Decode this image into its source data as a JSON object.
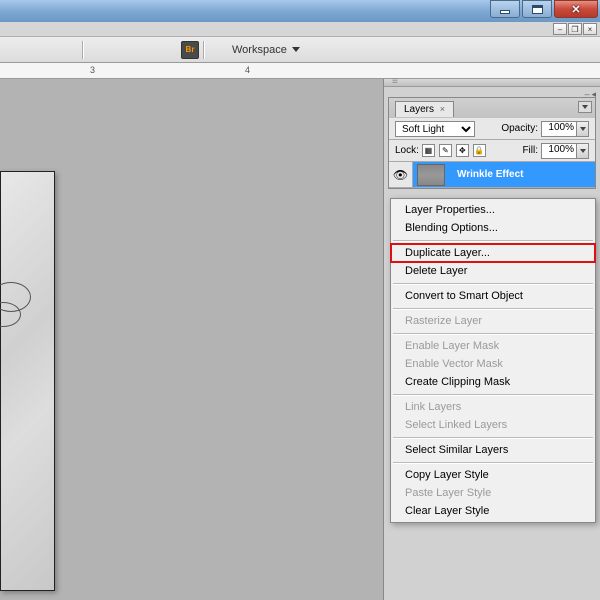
{
  "toolbar": {
    "bridge": "Br",
    "workspace_label": "Workspace"
  },
  "ruler": {
    "marks": [
      "3",
      "4"
    ]
  },
  "layers_panel": {
    "tab_label": "Layers",
    "blend_mode": "Soft Light",
    "opacity_label": "Opacity:",
    "opacity_value": "100%",
    "lock_label": "Lock:",
    "fill_label": "Fill:",
    "fill_value": "100%",
    "layer_name": "Wrinkle Effect"
  },
  "context_menu": {
    "items": [
      {
        "label": "Layer Properties...",
        "enabled": true
      },
      {
        "label": "Blending Options...",
        "enabled": true
      },
      {
        "sep": true
      },
      {
        "label": "Duplicate Layer...",
        "enabled": true,
        "highlighted": true
      },
      {
        "label": "Delete Layer",
        "enabled": true
      },
      {
        "sep": true
      },
      {
        "label": "Convert to Smart Object",
        "enabled": true
      },
      {
        "sep": true
      },
      {
        "label": "Rasterize Layer",
        "enabled": false
      },
      {
        "sep": true
      },
      {
        "label": "Enable Layer Mask",
        "enabled": false
      },
      {
        "label": "Enable Vector Mask",
        "enabled": false
      },
      {
        "label": "Create Clipping Mask",
        "enabled": true
      },
      {
        "sep": true
      },
      {
        "label": "Link Layers",
        "enabled": false
      },
      {
        "label": "Select Linked Layers",
        "enabled": false
      },
      {
        "sep": true
      },
      {
        "label": "Select Similar Layers",
        "enabled": true
      },
      {
        "sep": true
      },
      {
        "label": "Copy Layer Style",
        "enabled": true
      },
      {
        "label": "Paste Layer Style",
        "enabled": false
      },
      {
        "label": "Clear Layer Style",
        "enabled": true
      }
    ]
  }
}
